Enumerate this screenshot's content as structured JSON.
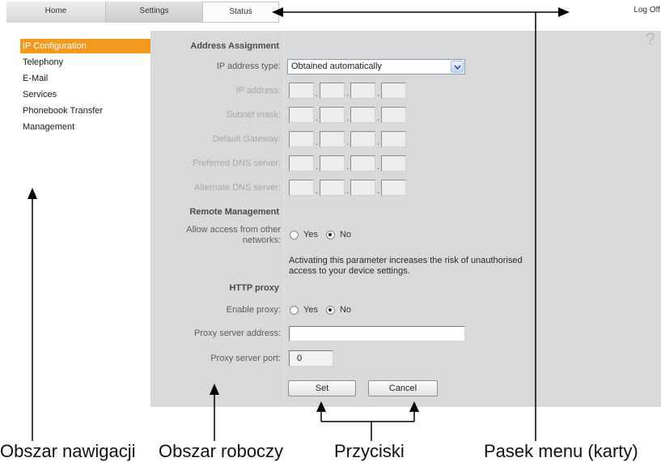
{
  "app": {
    "colors": {
      "accent": "#f39a1e",
      "work_area": "#d9d9d9"
    }
  },
  "tabs": [
    {
      "label": "Home"
    },
    {
      "label": "Settings"
    },
    {
      "label": "Status"
    }
  ],
  "log_off": "Log Off",
  "help_icon": "?",
  "nav": {
    "active": 0,
    "items": [
      {
        "label": "IP Configuration"
      },
      {
        "label": "Telephony"
      },
      {
        "label": "E-Mail"
      },
      {
        "label": "Services"
      },
      {
        "label": "Phonebook Transfer"
      },
      {
        "label": "Management"
      }
    ]
  },
  "form": {
    "address_assignment": {
      "heading": "Address Assignment",
      "ip_address_type": {
        "label": "IP address type:",
        "value": "Obtained automatically"
      },
      "ip_separator": ".",
      "ip_fields": [
        {
          "label": "IP address:"
        },
        {
          "label": "Subnet mask:"
        },
        {
          "label": "Default Gateway:"
        },
        {
          "label": "Preferred DNS server:"
        },
        {
          "label": "Alternate DNS server:"
        }
      ]
    },
    "remote_management": {
      "heading": "Remote Management",
      "allow_access": {
        "label_lines": [
          "Allow access from other",
          "networks:"
        ],
        "options": [
          "Yes",
          "No"
        ],
        "selected": 1
      },
      "warning_lines": [
        "Activating this parameter increases the risk of unauthorised",
        "access to your device settings."
      ]
    },
    "http_proxy": {
      "heading": "HTTP proxy",
      "enable_proxy": {
        "label": "Enable proxy:",
        "options": [
          "Yes",
          "No"
        ],
        "selected": 1
      },
      "proxy_server_address": {
        "label": "Proxy server address:",
        "value": ""
      },
      "proxy_server_port": {
        "label": "Proxy server port:",
        "value": "0"
      }
    },
    "buttons": {
      "set": "Set",
      "cancel": "Cancel"
    }
  },
  "annotations": {
    "navigation_area": "Obszar nawigacji",
    "work_area": "Obszar roboczy",
    "buttons": "Przyciski",
    "menu_bar": "Pasek menu (karty)"
  }
}
